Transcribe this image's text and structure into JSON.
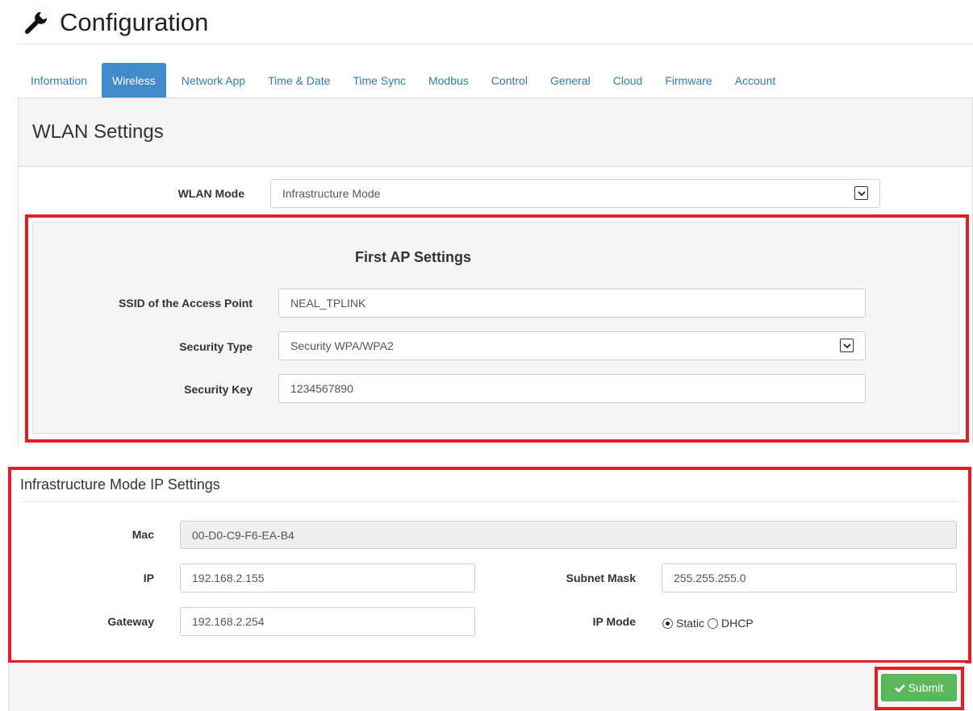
{
  "header": {
    "title": "Configuration",
    "icon": "wrench-icon"
  },
  "tabs": [
    {
      "label": "Information"
    },
    {
      "label": "Wireless",
      "active": true
    },
    {
      "label": "Network App"
    },
    {
      "label": "Time & Date"
    },
    {
      "label": "Time Sync"
    },
    {
      "label": "Modbus"
    },
    {
      "label": "Control"
    },
    {
      "label": "General"
    },
    {
      "label": "Cloud"
    },
    {
      "label": "Firmware"
    },
    {
      "label": "Account"
    }
  ],
  "wlan": {
    "heading": "WLAN Settings",
    "mode_label": "WLAN Mode",
    "mode_value": "Infrastructure Mode"
  },
  "ap": {
    "title": "First AP Settings",
    "ssid_label": "SSID of the Access Point",
    "ssid_value": "NEAL_TPLINK",
    "security_type_label": "Security Type",
    "security_type_value": "Security WPA/WPA2",
    "security_key_label": "Security Key",
    "security_key_value": "1234567890"
  },
  "ip": {
    "heading": "Infrastructure Mode IP Settings",
    "mac_label": "Mac",
    "mac_value": "00-D0-C9-F6-EA-B4",
    "ip_label": "IP",
    "ip_value": "192.168.2.155",
    "subnet_label": "Subnet Mask",
    "subnet_value": "255.255.255.0",
    "gateway_label": "Gateway",
    "gateway_value": "192.168.2.254",
    "mode_label": "IP Mode",
    "mode_options": [
      "Static",
      "DHCP"
    ],
    "mode_selected": "Static"
  },
  "actions": {
    "submit_label": "Submit"
  },
  "colors": {
    "accent": "#428bca",
    "link": "#337ab7",
    "success": "#5cb85c",
    "highlight": "#e31c25"
  }
}
